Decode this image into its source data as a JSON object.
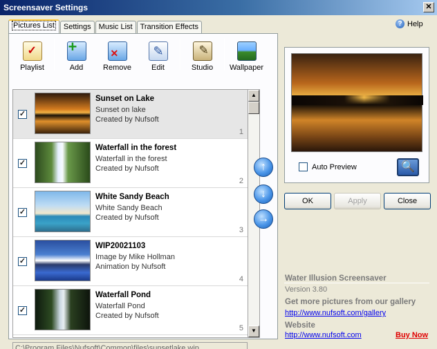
{
  "window": {
    "title": "Screensaver Settings",
    "close_glyph": "✕"
  },
  "tabs": [
    {
      "label": "Pictures List",
      "active": true
    },
    {
      "label": "Settings",
      "active": false
    },
    {
      "label": "Music List",
      "active": false
    },
    {
      "label": "Transition Effects",
      "active": false
    }
  ],
  "help": {
    "label": "Help",
    "icon": "help-icon"
  },
  "toolbar": {
    "playlist": "Playlist",
    "add": "Add",
    "remove": "Remove",
    "edit": "Edit",
    "studio": "Studio",
    "wallpaper": "Wallpaper"
  },
  "pictures": [
    {
      "title": "Sunset on Lake",
      "line1": "Sunset on lake",
      "line2": "Created by Nufsoft",
      "index": "1",
      "checked": true,
      "selected": true
    },
    {
      "title": "Waterfall in the forest",
      "line1": "Waterfall in the forest",
      "line2": "Created by Nufsoft",
      "index": "2",
      "checked": true,
      "selected": false
    },
    {
      "title": "White Sandy Beach",
      "line1": "White Sandy Beach",
      "line2": "Created by Nufsoft",
      "index": "3",
      "checked": true,
      "selected": false
    },
    {
      "title": "WIP20021103",
      "line1": "Image by Mike Hollman",
      "line2": "Animation by Nufsoft",
      "index": "4",
      "checked": true,
      "selected": false
    },
    {
      "title": "Waterfall Pond",
      "line1": "Waterfall Pond",
      "line2": "Created by Nufsoft",
      "index": "5",
      "checked": true,
      "selected": false
    }
  ],
  "check_glyph": "✓",
  "arrows": {
    "up": "↑",
    "down": "↓",
    "right": "→"
  },
  "scrollbar": {
    "up": "▲",
    "down": "▼"
  },
  "path": "C:\\Program Files\\Nufsoft\\Common\\files\\sunsetlake.wip",
  "preview": {
    "auto_preview_label": "Auto Preview",
    "auto_preview_checked": false,
    "magnify_glyph": "🔍"
  },
  "buttons": {
    "ok": "OK",
    "apply": "Apply",
    "close": "Close"
  },
  "info": {
    "product": "Water Illusion Screensaver",
    "version": "Version 3.80",
    "gallery_text": "Get more pictures from our gallery",
    "gallery_link": "http://www.nufsoft.com/gallery",
    "website_label": "Website",
    "website_link": "http://www.nufsoft.com",
    "buy_now": "Buy Now"
  }
}
